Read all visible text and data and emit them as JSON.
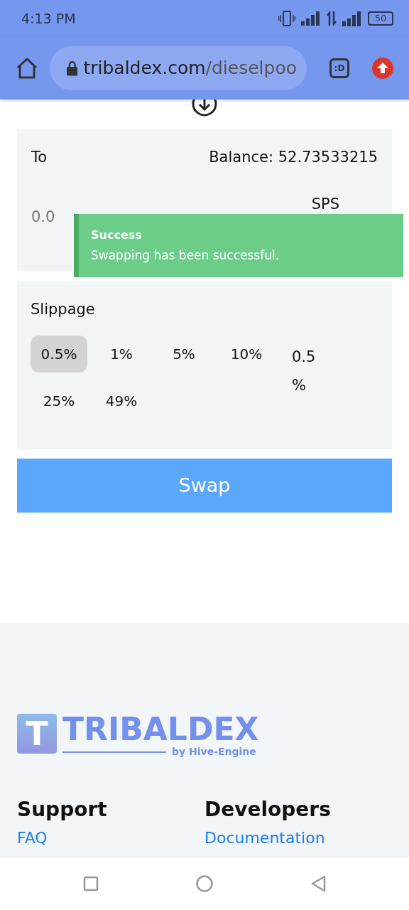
{
  "status_bar": {
    "time": "4:13 PM",
    "battery": "50"
  },
  "browser": {
    "url_host": "tribaldex.com",
    "url_path": "/dieselpoo",
    "tab_count": ":D"
  },
  "to_panel": {
    "label": "To",
    "balance": "Balance: 52.73533215",
    "amount_placeholder": "0.0",
    "token": "SPS"
  },
  "toast": {
    "title": "Success",
    "message": "Swapping has been successful."
  },
  "slippage": {
    "label": "Slippage",
    "options": [
      {
        "label": "0.5%",
        "selected": true
      },
      {
        "label": "1%",
        "selected": false
      },
      {
        "label": "5%",
        "selected": false
      },
      {
        "label": "10%",
        "selected": false
      },
      {
        "label": "25%",
        "selected": false
      },
      {
        "label": "49%",
        "selected": false
      }
    ],
    "custom": "0.5 %"
  },
  "swap_button": "Swap",
  "footer": {
    "logo": {
      "mark": "T",
      "name": "TRIBALDEX",
      "byline": "by Hive-Engine"
    },
    "columns": [
      {
        "heading": "Support",
        "links": [
          "FAQ"
        ]
      },
      {
        "heading": "Developers",
        "links": [
          "Documentation"
        ]
      }
    ]
  }
}
